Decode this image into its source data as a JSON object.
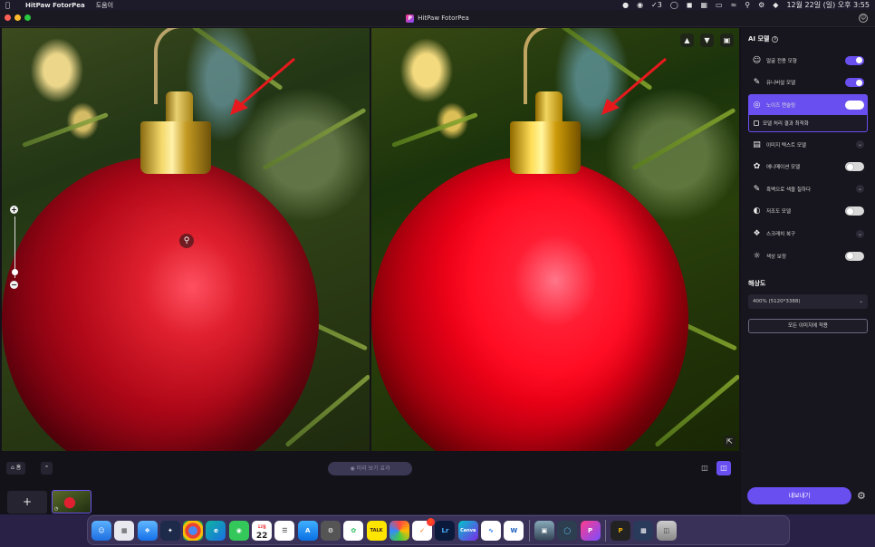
{
  "menubar": {
    "app_name": "HitPaw FotorPea",
    "help_menu": "도움이",
    "notification_count": "3",
    "datetime": "12월 22일 (일) 오후 3:55"
  },
  "window": {
    "title": "HitPaw FotorPea"
  },
  "sidebar": {
    "ai_models_title": "AI 모델",
    "models": [
      {
        "label": "얼굴 전용 모형",
        "icon": "face-icon",
        "control": "toggle",
        "state": "on"
      },
      {
        "label": "유니버설 모델",
        "icon": "universal-icon",
        "control": "toggle",
        "state": "on"
      },
      {
        "label": "노이즈 캔슬링",
        "icon": "denoise-icon",
        "control": "toggle",
        "state": "on",
        "active": true
      },
      {
        "label": "이미지 텍스트 모델",
        "icon": "text-image-icon",
        "control": "expand"
      },
      {
        "label": "애니메이션 모델",
        "icon": "animation-icon",
        "control": "toggle",
        "state": "off"
      },
      {
        "label": "흑백으로 색을 칠하다",
        "icon": "colorize-icon",
        "control": "expand"
      },
      {
        "label": "저조도 모델",
        "icon": "low-light-icon",
        "control": "toggle",
        "state": "off"
      },
      {
        "label": "스크래치 복구",
        "icon": "scratch-repair-icon",
        "control": "expand"
      },
      {
        "label": "색상 보정",
        "icon": "color-correct-icon",
        "control": "toggle",
        "state": "off"
      }
    ],
    "denoise_option": "모델 처리 결과 최적화",
    "resolution_title": "해상도",
    "resolution_value": "400% (5120*3388)",
    "apply_all_label": "모든 이미지에 적용",
    "export_label": "내보내기"
  },
  "bottombar": {
    "home_label": "홈",
    "preview_label": "미리 보기 효과"
  },
  "dock": {
    "calendar_month": "12월",
    "calendar_day": "22",
    "mail_badge": "1",
    "talk_label": "TALK",
    "canva_label": "Canva",
    "lightroom_label": "Lr",
    "word_label": "W"
  },
  "colors": {
    "accent": "#6a4ff0",
    "panel_bg": "#17151d"
  }
}
